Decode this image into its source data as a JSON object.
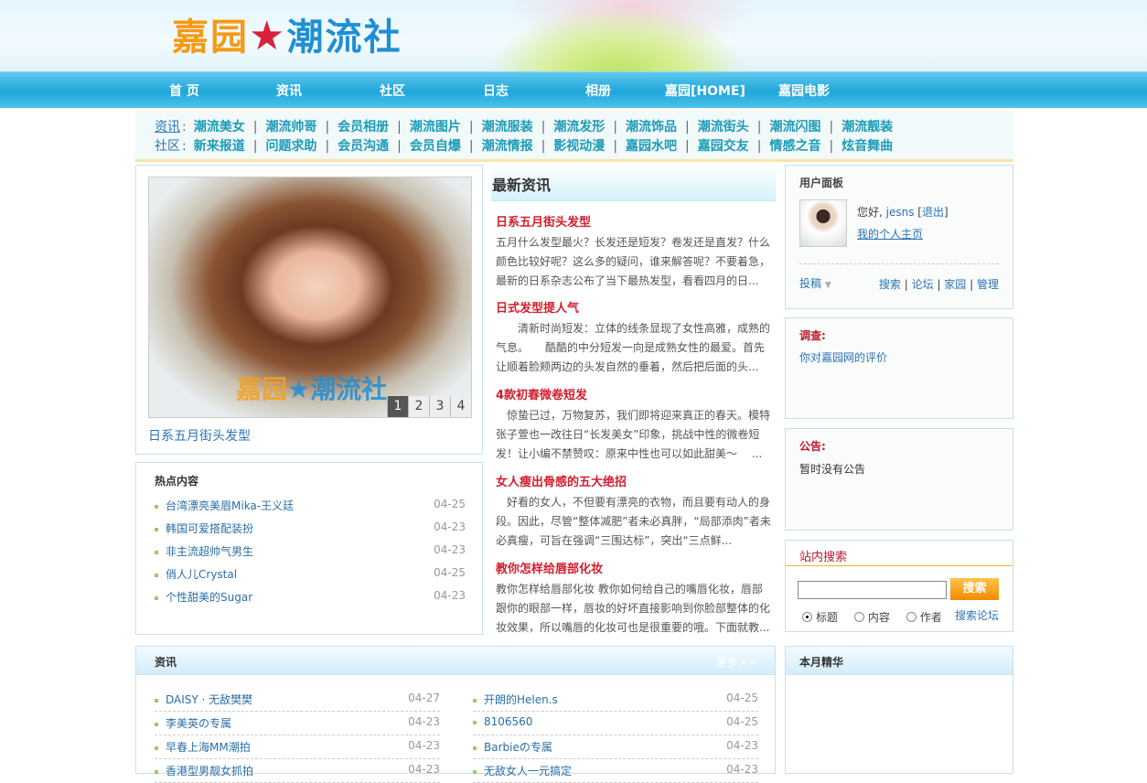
{
  "site": {
    "logo_text": "嘉园潮流社"
  },
  "nav": [
    "首 页",
    "资讯",
    "社区",
    "日志",
    "相册",
    "嘉园[HOME]",
    "嘉园电影"
  ],
  "subnav": {
    "row1": {
      "label": "资讯",
      "items": [
        "潮流美女",
        "潮流帅哥",
        "会员相册",
        "潮流图片",
        "潮流服装",
        "潮流发形",
        "潮流饰品",
        "潮流街头",
        "潮流闪图",
        "潮流靓装"
      ]
    },
    "row2": {
      "label": "社区",
      "items": [
        "新来报道",
        "问题求助",
        "会员沟通",
        "会员自爆",
        "潮流情报",
        "影视动漫",
        "嘉园水吧",
        "嘉园交友",
        "情感之音",
        "炫音舞曲"
      ]
    }
  },
  "slideshow": {
    "caption": "日系五月街头发型",
    "pages": [
      "1",
      "2",
      "3",
      "4"
    ],
    "active": 1,
    "watermark": "嘉园潮流社"
  },
  "hot": {
    "title": "热点内容",
    "items": [
      {
        "t": "台湾漂亮美眉Mika-王义廷",
        "d": "04-25"
      },
      {
        "t": "韩国可爱搭配装扮",
        "d": "04-23"
      },
      {
        "t": "非主流超帅气男生",
        "d": "04-23"
      },
      {
        "t": "俏人儿Crystal",
        "d": "04-25"
      },
      {
        "t": "个性甜美的Sugar",
        "d": "04-23"
      }
    ]
  },
  "news": {
    "title": "最新资讯",
    "articles": [
      {
        "h": "日系五月街头发型",
        "p": "五月什么发型最火？长发还是短发？卷发还是直发？什么颜色比较好呢？这么多的疑问，谁来解答呢？不要着急，最新的日系杂志公布了当下最热发型，看看四月的日..."
      },
      {
        "h": "日式发型提人气",
        "p": "　　清新时尚短发：立体的线条显现了女性高雅，成熟的气息。　　酷酷的中分短发一向是成熟女性的最爱。首先让顺着脸颊两边的头发自然的垂着，然后把后面的头..."
      },
      {
        "h": "4款初春微卷短发",
        "p": "　惊蛰已过，万物复苏，我们即将迎来真正的春天。模特张子萱也一改往日“长发美女”印象，挑战中性的微卷短发！让小编不禁赞叹：原来中性也可以如此甜美～　 ..."
      },
      {
        "h": "女人瘦出骨感的五大绝招",
        "p": "　好看的女人，不但要有漂亮的衣物，而且要有动人的身段。因此，尽管“整体减肥”者未必真胖，“局部添肉”者未必真瘦，可旨在强调“三围达标”，突出“三点鲜..."
      },
      {
        "h": "教你怎样给唇部化妆",
        "p": "教你怎样给唇部化妆 教你如何给自己的嘴唇化妆，唇部跟你的眼部一样，唇妆的好坏直接影响到你脸部整体的化妆效果，所以嘴唇的化妆可也是很重要的哦。下面就教..."
      }
    ]
  },
  "user": {
    "title": "用户面板",
    "greeting": "您好,",
    "name": "jesns",
    "logout": "退出",
    "home": "我的个人主页",
    "post": "投稿",
    "links": [
      "搜索",
      "论坛",
      "家园",
      "管理"
    ]
  },
  "survey": {
    "title": "调查:",
    "item": "你对嘉园网的评价"
  },
  "notice": {
    "title": "公告:",
    "text": "暂时没有公告"
  },
  "search": {
    "title": "站内搜索",
    "value": "",
    "button": "搜索",
    "options": [
      "标题",
      "内容",
      "作者"
    ],
    "selected": 0,
    "forum": "搜索论坛"
  },
  "info": {
    "title": "资讯",
    "more": "更多>>",
    "left": [
      {
        "t": "DAISY · 无敌樊樊",
        "d": "04-27"
      },
      {
        "t": "李美英の专属",
        "d": "04-23"
      },
      {
        "t": "早春上海MM潮拍",
        "d": "04-23"
      },
      {
        "t": "香港型男靓女抓拍",
        "d": "04-23"
      }
    ],
    "right": [
      {
        "t": "开朗的Helen.s",
        "d": "04-25"
      },
      {
        "t": "8106560",
        "d": "04-25"
      },
      {
        "t": "Barbieの专属",
        "d": "04-23"
      },
      {
        "t": "无敌女人一元搞定",
        "d": "04-23"
      }
    ]
  },
  "monthly": {
    "title": "本月精华"
  }
}
